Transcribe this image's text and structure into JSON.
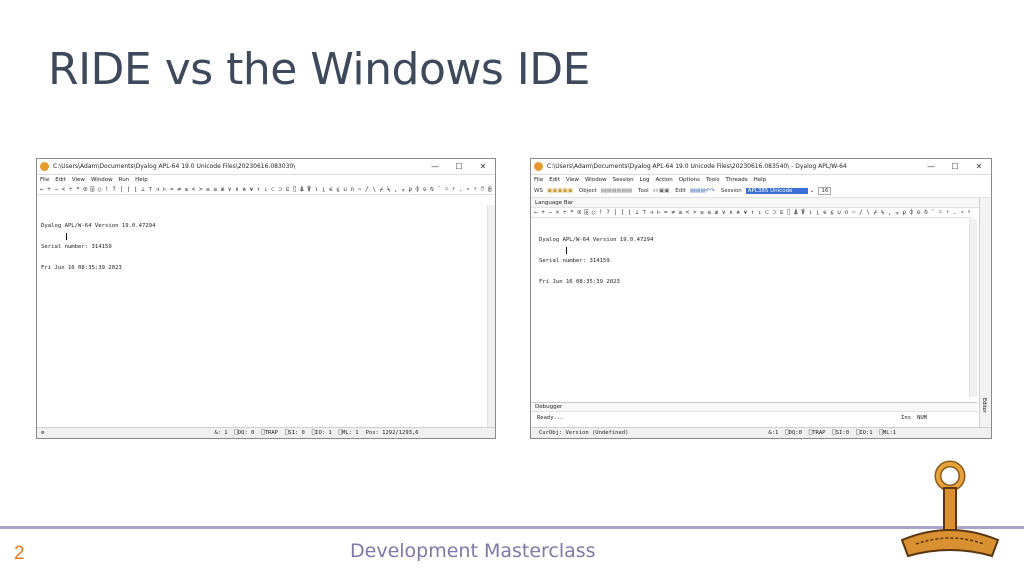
{
  "slide": {
    "title": "RIDE vs the Windows IDE",
    "footer": "Development Masterclass",
    "page_number": "2"
  },
  "ride": {
    "window_title": "C:\\Users\\Adam\\Documents\\Dyalog APL-64 19.0 Unicode Files\\20230616.083030\\",
    "menu": [
      "File",
      "Edit",
      "View",
      "Window",
      "Run",
      "Help"
    ],
    "language_bar": "← + − × ÷ * ⍟ ⌹ ○ ! ? | ⌈ ⌊ ⊥ ⊤ ⊣ ⊢ = ≠ ≤ < > ≥ ≡ ≢ ∨ ∧ ⍲ ⍱ ↑ ↓ ⊂ ⊃ ⊆ ⌷ ⍋ ⍒ ⍳ ⍸ ∊ ⍷ ∪ ∩ ~ / \\ ⌿ ⍀ , ⍪ ⍴ ⌽ ⊖ ⍉ ¨ ⍨ ⍣ . ∘ ⍤ ⍥ @ ⎕ ⍠ ⌸ ⌺ ⌶ ⍎ ⍕ ⋄ ⍝ → ⍵ ⍺ ∇ & ¯ ⍬",
    "session_lines": [
      "Dyalog APL/W-64 Version 19.0.47294",
      "Serial number: 314159",
      "Fri Jun 16 08:35:39 2023"
    ],
    "status": [
      "&: 1",
      "⎕DQ: 0",
      "⎕TRAP",
      "⎕SI: 0",
      "⎕IO: 1",
      "⎕ML: 1",
      "Pos: 1292/1293,6"
    ],
    "gear_icon": "gear-icon"
  },
  "win_ide": {
    "window_title": "C:\\Users\\Adam\\Documents\\Dyalog APL-64 19.0 Unicode Files\\20230616.083540\\ - Dyalog APL/W-64",
    "menu": [
      "File",
      "Edit",
      "View",
      "Window",
      "Session",
      "Log",
      "Action",
      "Options",
      "Tools",
      "Threads",
      "Help"
    ],
    "toolbar": {
      "ws_label": "WS",
      "object_label": "Object",
      "tool_label": "Tool",
      "edit_label": "Edit",
      "session_label": "Session",
      "font_select": "APL385 Unicode",
      "font_size": "16"
    },
    "language_bar_title": "Language Bar",
    "language_bar": "← + − × ÷ * ⍟ ⌹ ○ ! ? | ⌈ ⌊ ⊥ ⊤ ⊣ ⊢ = ≠ ≤ < > ≥ ≡ ≢ ∨ ∧ ⍲ ⍱ ↑ ↓ ⊂ ⊃ ⊆ ⌷ ⍋ ⍒ ⍳ ⍸ ∊ ⍷ ∪ ∩ ~ / \\ ⌿ ⍀ , ⍪ ⍴ ⌽ ⊖ ⍉ ¨ ⍨ ⍣ . ∘ ⍤ ⍥ @ ⎕ ⍠ ⌸ ⌺ ⌶ ⍎ ⍕ ⋄ ⍝ → ⍵ ⍺ ∇ & ¯ ⍬",
    "session_lines": [
      "Dyalog APL/W-64 Version 19.0.47294",
      "Serial number: 314159",
      "Fri Jun 16 08:35:39 2023"
    ],
    "side_label": "Editor",
    "debugger_title": "Debugger",
    "debugger_status": "Ready...",
    "ins": "Ins",
    "num": "NUM",
    "status": [
      "CurObj: Version (Undefined)",
      "&:1",
      "⎕DQ:0",
      "⎕TRAP",
      "⎕SI:0",
      "⎕IO:1",
      "⎕ML:1"
    ]
  }
}
